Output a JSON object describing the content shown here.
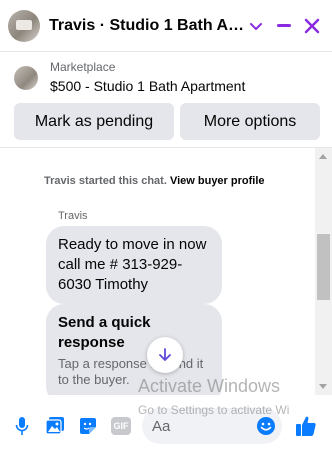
{
  "header": {
    "title": "Travis · Studio 1 Bath Apart...",
    "accent_color": "#8a2be2",
    "avatar_icon": "listing-photo-avatar",
    "chevron_icon": "chevron-down-icon",
    "minimize_icon": "minimize-icon",
    "close_icon": "close-icon"
  },
  "listing": {
    "source": "Marketplace",
    "title": "$500 - Studio 1 Bath Apartment",
    "mark_pending_label": "Mark as pending",
    "more_options_label": "More options"
  },
  "chat": {
    "started_text": "Travis started this chat.",
    "view_profile_label": "View buyer profile",
    "sender": "Travis",
    "message_lines": [
      "Ready to move in now",
      "call me # 313-929-",
      "6030 Timothy"
    ],
    "quick_response_title": "Send a quick response",
    "quick_response_sub": "Tap a response to send it to the buyer."
  },
  "composer": {
    "placeholder": "Aa",
    "gif_label": "GIF",
    "icons": [
      "microphone-icon",
      "photo-icon",
      "sticker-icon",
      "gif-icon",
      "emoji-icon",
      "thumbs-up-icon"
    ],
    "brand_blue": "#0a7cff"
  },
  "watermark": {
    "title": "Activate Windows",
    "sub": "Go to Settings to activate Wi"
  }
}
